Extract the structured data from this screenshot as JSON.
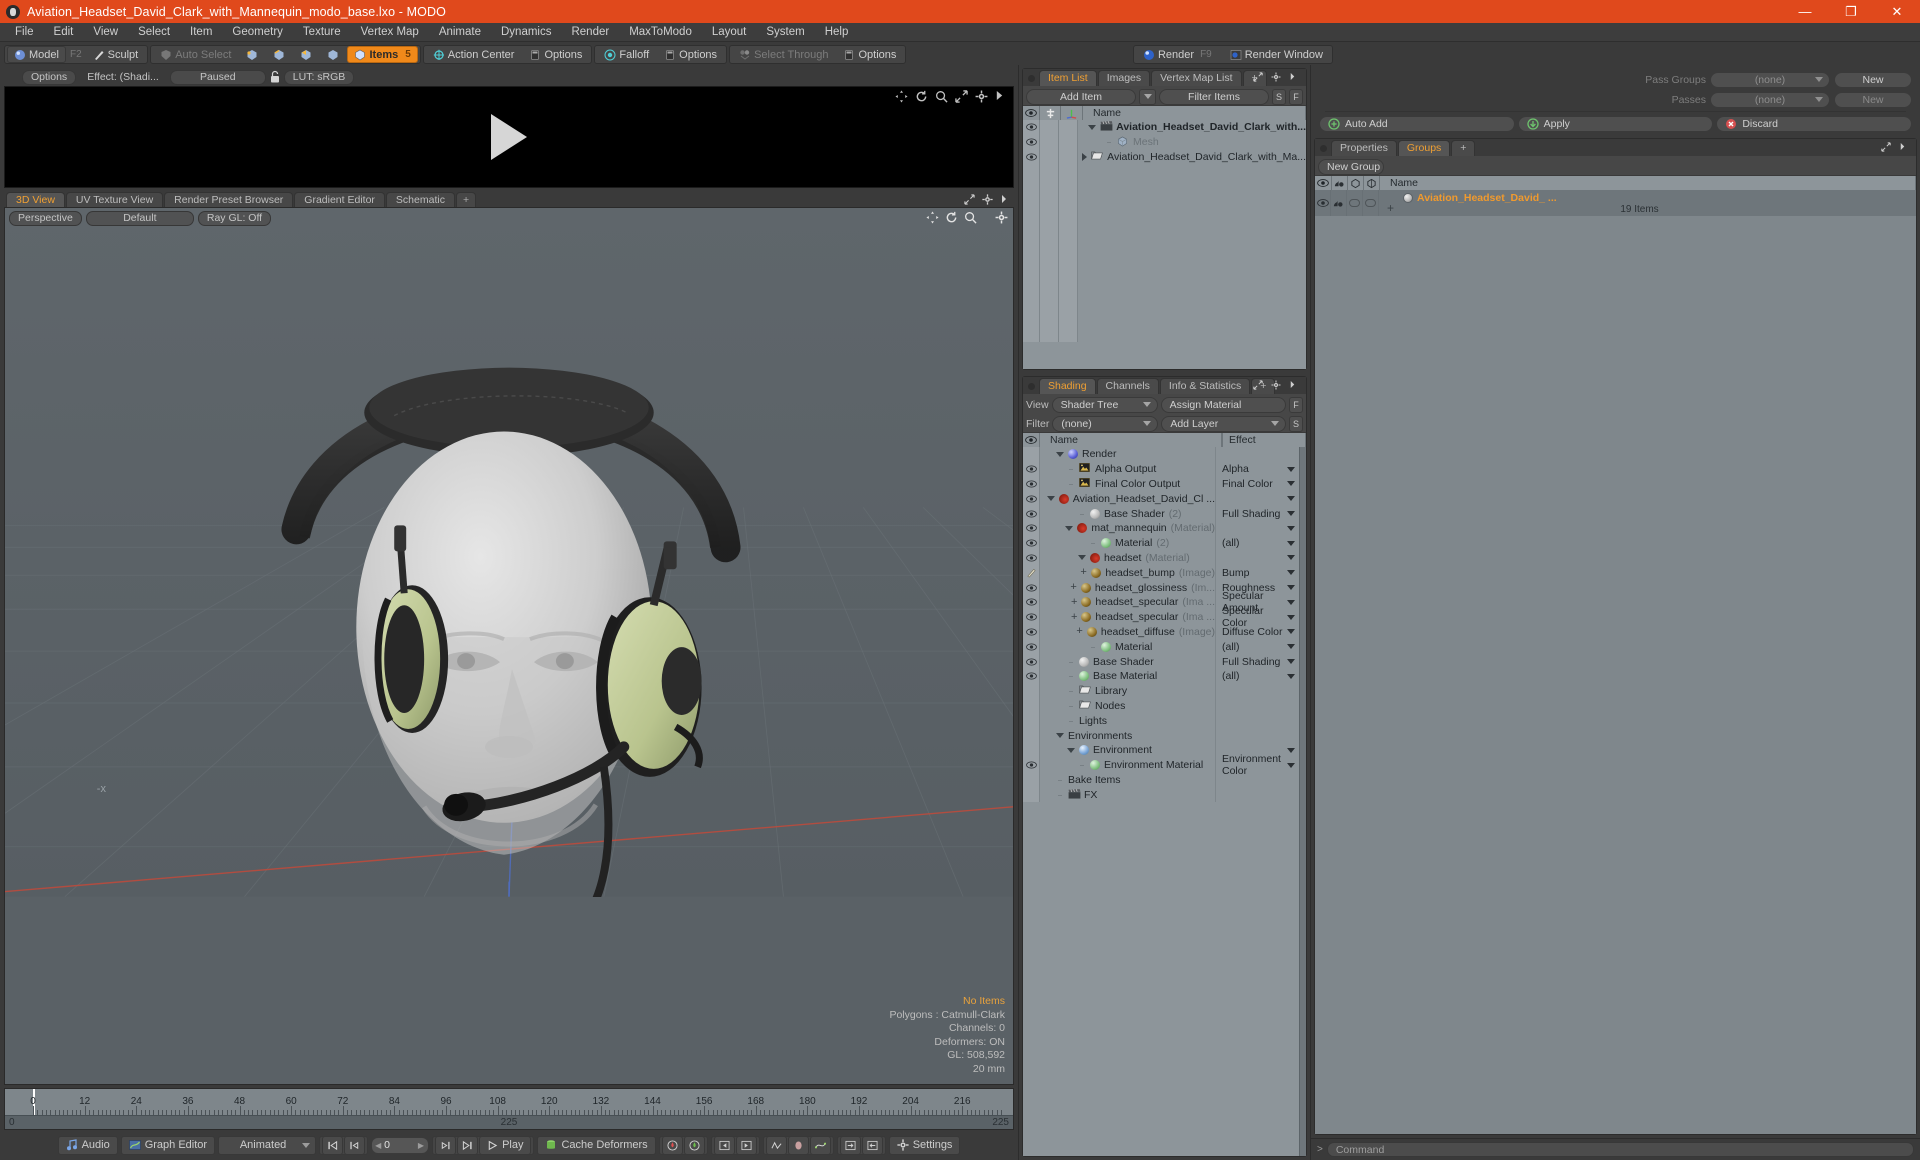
{
  "window": {
    "title": "Aviation_Headset_David_Clark_with_Mannequin_modo_base.lxo - MODO",
    "minimize": "—",
    "maximize": "❐",
    "close": "✕"
  },
  "menubar": [
    "File",
    "Edit",
    "View",
    "Select",
    "Item",
    "Geometry",
    "Texture",
    "Vertex Map",
    "Animate",
    "Dynamics",
    "Render",
    "MaxToModo",
    "Layout",
    "System",
    "Help"
  ],
  "toolbar": {
    "model": "Model",
    "model_key": "F2",
    "sculpt": "Sculpt",
    "auto_select": "Auto Select",
    "items": "Items",
    "items_count": "5",
    "action_center": "Action Center",
    "options1": "Options",
    "falloff": "Falloff",
    "options2": "Options",
    "select_through": "Select Through",
    "options3": "Options",
    "render": "Render",
    "render_key": "F9",
    "render_window": "Render Window"
  },
  "preview": {
    "options": "Options",
    "effect": "Effect: (Shadi...",
    "paused": "Paused",
    "lut": "LUT: sRGB"
  },
  "viewport_tabs": [
    {
      "label": "3D View",
      "active": true
    },
    {
      "label": "UV Texture View",
      "active": false
    },
    {
      "label": "Render Preset Browser",
      "active": false
    },
    {
      "label": "Gradient Editor",
      "active": false
    },
    {
      "label": "Schematic",
      "active": false
    },
    {
      "label": "+",
      "active": false
    }
  ],
  "viewport": {
    "perspective": "Perspective",
    "shading": "Default",
    "raygl": "Ray GL: Off",
    "stats": {
      "no_items": "No Items",
      "polygons": "Polygons : Catmull-Clark",
      "channels": "Channels: 0",
      "deformers": "Deformers: ON",
      "gl": "GL: 508,592",
      "scale": "20 mm"
    }
  },
  "timeline": {
    "ticks": [
      0,
      12,
      24,
      36,
      48,
      60,
      72,
      84,
      96,
      108,
      120,
      132,
      144,
      156,
      168,
      180,
      192,
      204,
      216
    ],
    "range_start": "0",
    "range_end": "225",
    "range_center": "225",
    "cursor_frame": 0
  },
  "playbar": {
    "audio": "Audio",
    "graph_editor": "Graph Editor",
    "mode": "Animated",
    "frame": "0",
    "play": "Play",
    "cache_deformers": "Cache Deformers",
    "settings": "Settings"
  },
  "item_list": {
    "tabs": [
      {
        "label": "Item List",
        "active": true
      },
      {
        "label": "Images",
        "active": false
      },
      {
        "label": "Vertex Map List",
        "active": false
      },
      {
        "label": "+",
        "active": false
      }
    ],
    "add_item": "Add Item",
    "filter_items": "Filter Items",
    "btn_s": "S",
    "btn_f": "F",
    "column_name": "Name",
    "rows": [
      {
        "label": "Aviation_Headset_David_Clark_with...",
        "icon": "clapper-icon",
        "indent": 1,
        "twist": "down",
        "bold": true,
        "dim": false
      },
      {
        "label": "Mesh",
        "icon": "mesh-icon",
        "indent": 2,
        "twist": "none",
        "bold": false,
        "dim": true
      },
      {
        "label": "Aviation_Headset_David_Clark_with_Ma...",
        "icon": "folder-icon",
        "indent": 2,
        "twist": "right",
        "bold": false,
        "dim": false
      }
    ]
  },
  "shading": {
    "tabs": [
      {
        "label": "Shading",
        "active": true
      },
      {
        "label": "Channels",
        "active": false
      },
      {
        "label": "Info & Statistics",
        "active": false
      },
      {
        "label": "+",
        "active": false
      }
    ],
    "view_label": "View",
    "view_value": "Shader Tree",
    "assign_material": "Assign Material",
    "filter_label": "Filter",
    "filter_value": "(none)",
    "add_layer": "Add Layer",
    "btn_f": "F",
    "btn_s": "S",
    "column_name": "Name",
    "column_effect": "Effect",
    "rows": [
      {
        "name": "Render",
        "sub": "",
        "effect": "",
        "icon": "sphere-blue",
        "indent": 1,
        "twist": "down",
        "eye": false,
        "brush": false
      },
      {
        "name": "Alpha Output",
        "sub": "",
        "effect": "Alpha",
        "icon": "image-icon",
        "indent": 2,
        "twist": "none",
        "eye": true,
        "brush": false
      },
      {
        "name": "Final Color Output",
        "sub": "",
        "effect": "Final Color",
        "icon": "image-icon",
        "indent": 2,
        "twist": "none",
        "eye": true,
        "brush": false
      },
      {
        "name": "Aviation_Headset_David_Cl ...",
        "sub": "",
        "effect": "",
        "icon": "sphere-red",
        "indent": 2,
        "twist": "down",
        "eye": true,
        "brush": false
      },
      {
        "name": "Base Shader",
        "sub": "(2)",
        "effect": "Full Shading",
        "icon": "sphere-gray",
        "indent": 3,
        "twist": "none",
        "eye": true,
        "brush": false
      },
      {
        "name": "mat_mannequin",
        "sub": "(Material)",
        "effect": "",
        "icon": "sphere-red",
        "indent": 3,
        "twist": "down",
        "eye": true,
        "brush": false
      },
      {
        "name": "Material",
        "sub": "(2)",
        "effect": "(all)",
        "icon": "sphere-green",
        "indent": 4,
        "twist": "none",
        "eye": true,
        "brush": false
      },
      {
        "name": "headset",
        "sub": "(Material)",
        "effect": "",
        "icon": "sphere-red",
        "indent": 3,
        "twist": "down",
        "eye": true,
        "brush": false
      },
      {
        "name": "headset_bump",
        "sub": "(Image)",
        "effect": "Bump",
        "icon": "sphere-brown",
        "indent": 4,
        "twist": "plus",
        "eye": false,
        "brush": true
      },
      {
        "name": "headset_glossiness",
        "sub": "(Im...",
        "effect": "Roughness",
        "icon": "sphere-brown",
        "indent": 4,
        "twist": "plus",
        "eye": true,
        "brush": false
      },
      {
        "name": "headset_specular",
        "sub": "(Ima ...",
        "effect": "Specular Amount",
        "icon": "sphere-brown",
        "indent": 4,
        "twist": "plus",
        "eye": true,
        "brush": false
      },
      {
        "name": "headset_specular",
        "sub": "(Ima ...",
        "effect": "Specular Color",
        "icon": "sphere-brown",
        "indent": 4,
        "twist": "plus",
        "eye": true,
        "brush": false
      },
      {
        "name": "headset_diffuse",
        "sub": "(Image)",
        "effect": "Diffuse Color",
        "icon": "sphere-brown",
        "indent": 4,
        "twist": "plus",
        "eye": true,
        "brush": false
      },
      {
        "name": "Material",
        "sub": "",
        "effect": "(all)",
        "icon": "sphere-green",
        "indent": 4,
        "twist": "none",
        "eye": true,
        "brush": false
      },
      {
        "name": "Base Shader",
        "sub": "",
        "effect": "Full Shading",
        "icon": "sphere-gray",
        "indent": 2,
        "twist": "none",
        "eye": true,
        "brush": false
      },
      {
        "name": "Base Material",
        "sub": "",
        "effect": "(all)",
        "icon": "sphere-green",
        "indent": 2,
        "twist": "none",
        "eye": true,
        "brush": false
      },
      {
        "name": "Library",
        "sub": "",
        "effect": "",
        "icon": "folder-icon",
        "indent": 2,
        "twist": "none",
        "eye": false,
        "brush": false
      },
      {
        "name": "Nodes",
        "sub": "",
        "effect": "",
        "icon": "folder-icon",
        "indent": 2,
        "twist": "none",
        "eye": false,
        "brush": false
      },
      {
        "name": "Lights",
        "sub": "",
        "effect": "",
        "icon": "none",
        "indent": 2,
        "twist": "none",
        "eye": false,
        "brush": false
      },
      {
        "name": "Environments",
        "sub": "",
        "effect": "",
        "icon": "none",
        "indent": 1,
        "twist": "down",
        "eye": false,
        "brush": false
      },
      {
        "name": "Environment",
        "sub": "",
        "effect": "",
        "icon": "sphere-env",
        "indent": 2,
        "twist": "down",
        "eye": false,
        "brush": false
      },
      {
        "name": "Environment Material",
        "sub": "",
        "effect": "Environment Color",
        "icon": "sphere-green",
        "indent": 3,
        "twist": "none",
        "eye": true,
        "brush": false
      },
      {
        "name": "Bake Items",
        "sub": "",
        "effect": "",
        "icon": "none",
        "indent": 1,
        "twist": "none",
        "eye": false,
        "brush": false
      },
      {
        "name": "FX",
        "sub": "",
        "effect": "",
        "icon": "clapper-icon",
        "indent": 1,
        "twist": "none",
        "eye": false,
        "brush": false
      }
    ]
  },
  "passes": {
    "pass_groups_label": "Pass Groups",
    "pass_groups_value": "(none)",
    "pass_groups_new": "New",
    "passes_label": "Passes",
    "passes_value": "(none)",
    "passes_new": "New",
    "auto_add": "Auto Add",
    "apply": "Apply",
    "discard": "Discard"
  },
  "groups": {
    "tabs": [
      {
        "label": "Properties",
        "active": false
      },
      {
        "label": "Groups",
        "active": true
      },
      {
        "label": "+",
        "active": false
      }
    ],
    "new_group": "New Group",
    "column_name": "Name",
    "rows": [
      {
        "name": "Aviation_Headset_David_ ...",
        "count": "19 Items"
      }
    ]
  },
  "command_bar": {
    "placeholder": "Command"
  },
  "colors": {
    "titlebar": "#e0491c",
    "accent_orange": "#f0a033",
    "selected_button": "#f0891a",
    "panel_bg": "#3f3f3f",
    "list_bg": "#8d959a",
    "viewport_bg": "#5a6166"
  }
}
